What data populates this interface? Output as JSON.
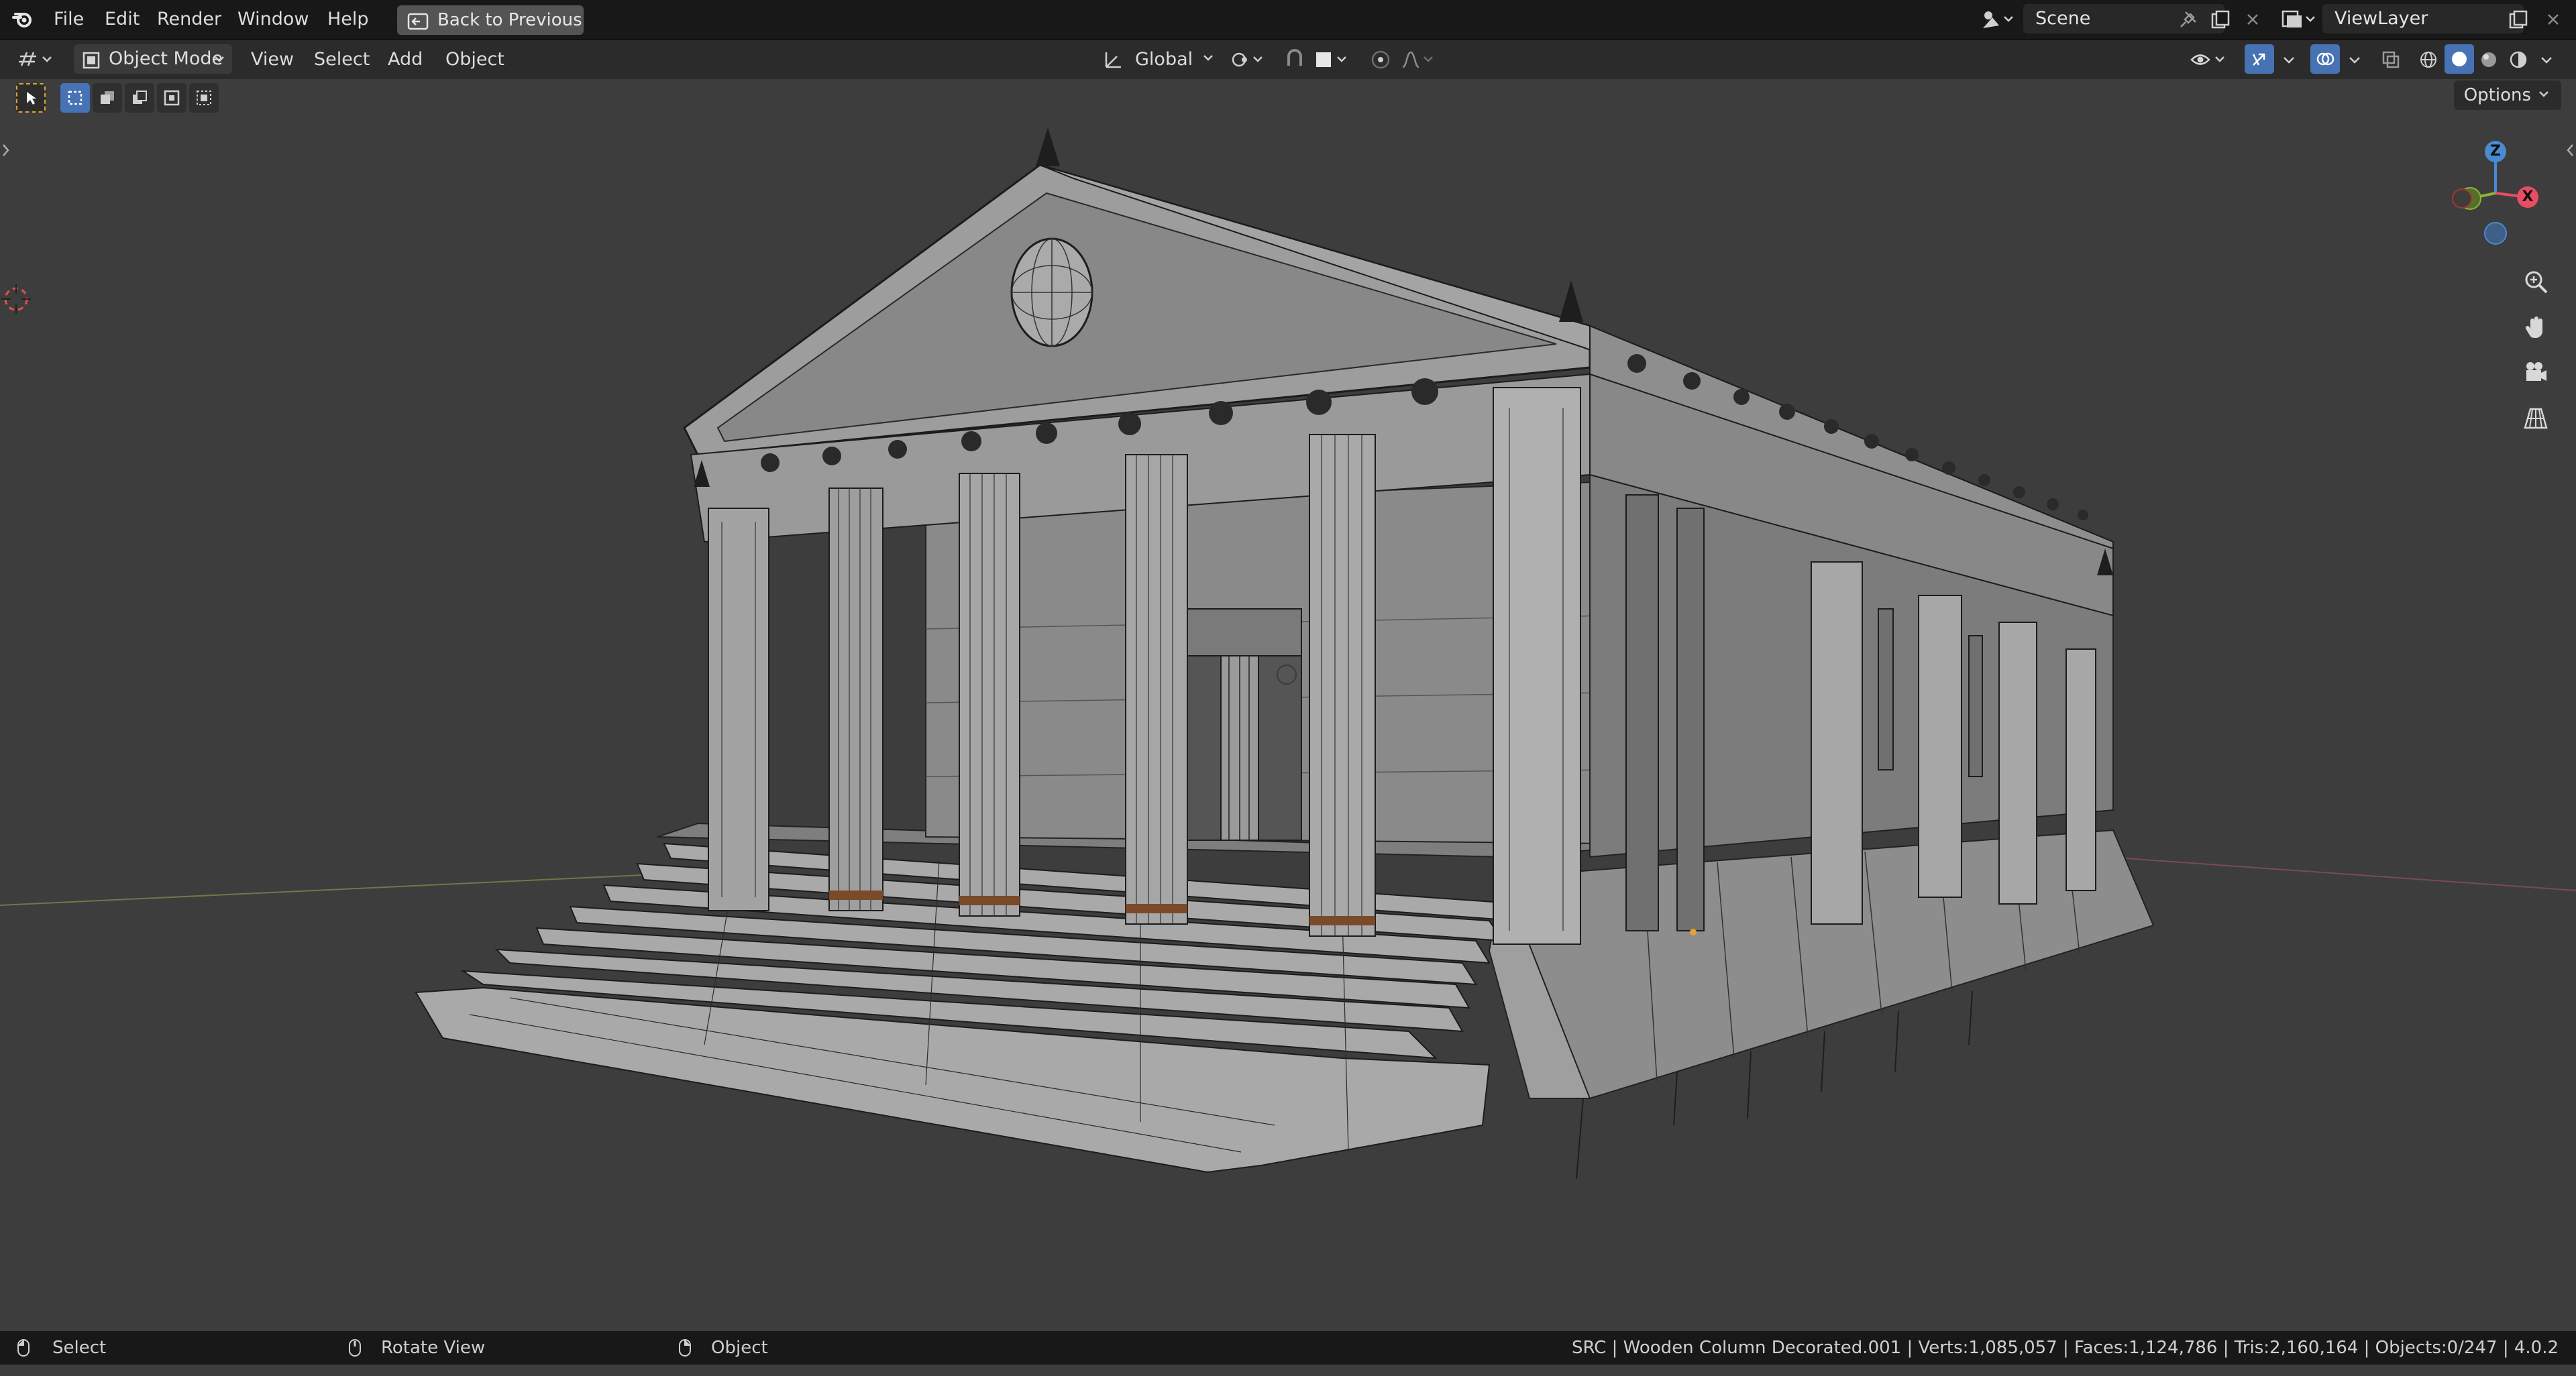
{
  "menu": {
    "file": "File",
    "edit": "Edit",
    "render": "Render",
    "window": "Window",
    "help": "Help",
    "back_to_previous": "Back to Previous"
  },
  "scene": {
    "name": "Scene"
  },
  "view_layer": {
    "name": "ViewLayer"
  },
  "header": {
    "mode": "Object Mode",
    "view": "View",
    "select": "Select",
    "add": "Add",
    "object": "Object",
    "transform_orientation": "Global"
  },
  "viewport": {
    "options": "Options",
    "gizmo": {
      "z": "Z",
      "x": "X"
    }
  },
  "status": {
    "select": "Select",
    "rotate_view": "Rotate View",
    "object": "Object",
    "stats": "SRC | Wooden Column Decorated.001 | Verts:1,085,057 | Faces:1,124,786 | Tris:2,160,164 | Objects:0/247 | 4.0.2"
  },
  "colors": {
    "accent": "#4772b3",
    "axis_x": "#e84d63",
    "axis_y": "#8bb43a",
    "axis_z": "#4a8ad1"
  }
}
